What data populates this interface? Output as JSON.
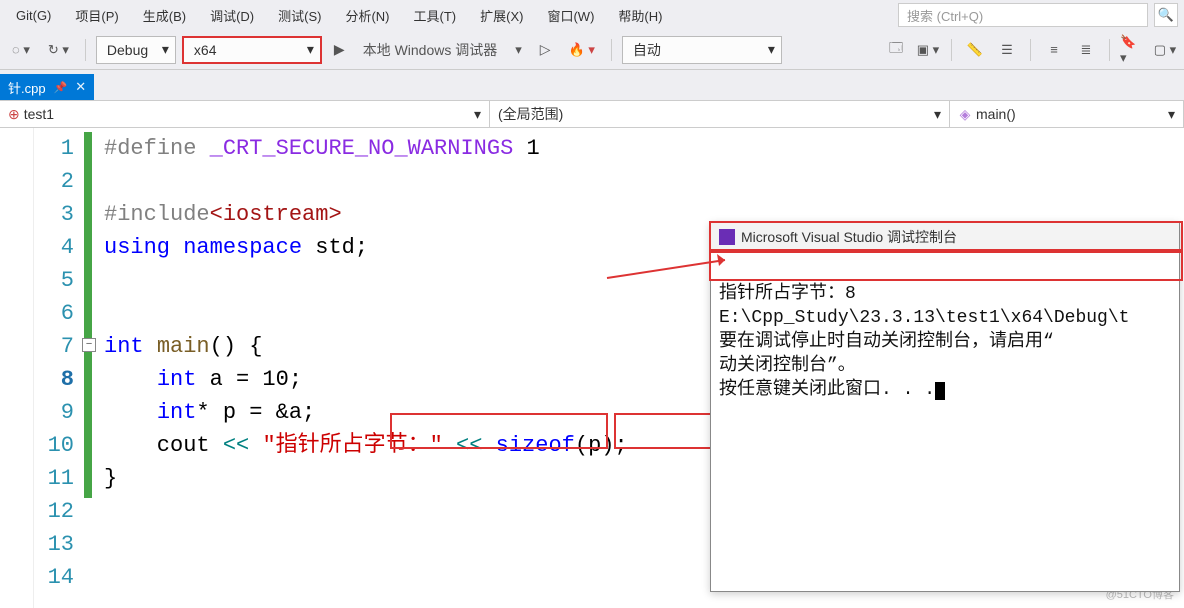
{
  "menu": {
    "items": [
      "Git(G)",
      "项目(P)",
      "生成(B)",
      "调试(D)",
      "测试(S)",
      "分析(N)",
      "工具(T)",
      "扩展(X)",
      "窗口(W)",
      "帮助(H)"
    ],
    "search_placeholder": "搜索 (Ctrl+Q)"
  },
  "toolbar": {
    "config": "Debug",
    "platform": "x64",
    "debugger_label": "本地 Windows 调试器",
    "auto_label": "自动"
  },
  "tab": {
    "filename": "针.cpp"
  },
  "nav": {
    "project": "test1",
    "scope": "(全局范围)",
    "func": "main()"
  },
  "editor": {
    "lines": [
      {
        "n": 1,
        "tokens": [
          {
            "c": "c-macro",
            "t": "#define "
          },
          {
            "c": "c-macro-name",
            "t": "_CRT_SECURE_NO_WARNINGS"
          },
          {
            "c": "",
            "t": " 1"
          }
        ]
      },
      {
        "n": 2,
        "tokens": []
      },
      {
        "n": 3,
        "tokens": [
          {
            "c": "c-macro",
            "t": "#include"
          },
          {
            "c": "c-inc",
            "t": "<iostream>"
          }
        ]
      },
      {
        "n": 4,
        "tokens": [
          {
            "c": "c-kw",
            "t": "using "
          },
          {
            "c": "c-kw",
            "t": "namespace"
          },
          {
            "c": "",
            "t": " std;"
          }
        ]
      },
      {
        "n": 5,
        "tokens": []
      },
      {
        "n": 6,
        "tokens": []
      },
      {
        "n": 7,
        "tokens": [
          {
            "c": "c-kw",
            "t": "int "
          },
          {
            "c": "c-func",
            "t": "main"
          },
          {
            "c": "",
            "t": "() {"
          }
        ],
        "fold": true
      },
      {
        "n": 8,
        "tokens": [
          {
            "c": "",
            "t": "    "
          },
          {
            "c": "c-kw",
            "t": "int"
          },
          {
            "c": "",
            "t": " a = 10;"
          }
        ],
        "current": true
      },
      {
        "n": 9,
        "tokens": [
          {
            "c": "",
            "t": "    "
          },
          {
            "c": "c-kw",
            "t": "int"
          },
          {
            "c": "",
            "t": "* p = &a;"
          }
        ]
      },
      {
        "n": 10,
        "tokens": [
          {
            "c": "",
            "t": "    cout "
          },
          {
            "c": "c-op",
            "t": "<<"
          },
          {
            "c": "",
            "t": " "
          },
          {
            "c": "c-str",
            "t": "\"指针所占字节：\""
          },
          {
            "c": "",
            "t": " "
          },
          {
            "c": "c-op",
            "t": "<<"
          },
          {
            "c": "",
            "t": " "
          },
          {
            "c": "c-sizeof",
            "t": "sizeof"
          },
          {
            "c": "",
            "t": "(p);"
          }
        ]
      },
      {
        "n": 11,
        "tokens": [
          {
            "c": "",
            "t": "}"
          }
        ]
      },
      {
        "n": 12,
        "tokens": []
      },
      {
        "n": 13,
        "tokens": []
      },
      {
        "n": 14,
        "tokens": []
      }
    ]
  },
  "console": {
    "title": "Microsoft Visual Studio 调试控制台",
    "line1": "指针所占字节：8",
    "line2": "E:\\Cpp_Study\\23.3.13\\test1\\x64\\Debug\\t",
    "line3": "要在调试停止时自动关闭控制台，请启用“",
    "line4": "动关闭控制台”。",
    "line5": "按任意键关闭此窗口. . ."
  },
  "watermark": "@51CTO博客"
}
